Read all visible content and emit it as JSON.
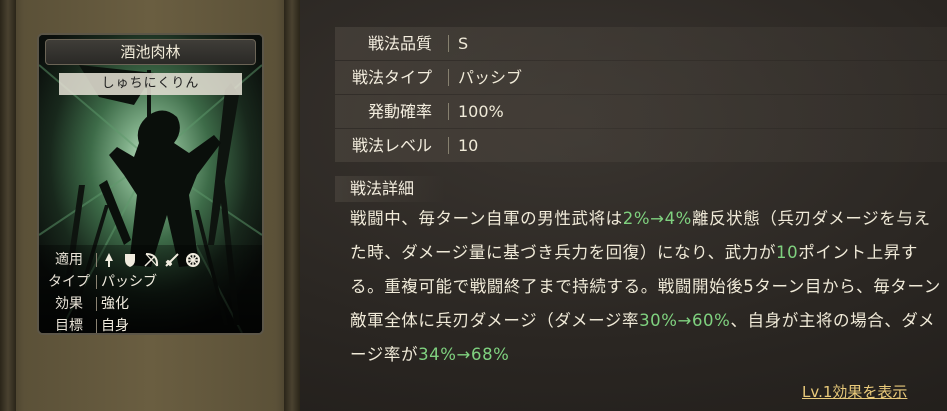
{
  "card": {
    "title": "酒池肉林",
    "reading": "しゅちにくりん",
    "info": [
      {
        "label": "適用",
        "value": ""
      },
      {
        "label": "タイプ",
        "value": "パッシブ"
      },
      {
        "label": "効果",
        "value": "強化"
      },
      {
        "label": "目標",
        "value": "自身"
      }
    ],
    "apply_icons": [
      "spear-icon",
      "shield-icon",
      "bow-icon",
      "sword-icon",
      "siege-icon"
    ]
  },
  "stats": [
    {
      "label": "戦法品質",
      "value": "S"
    },
    {
      "label": "戦法タイプ",
      "value": "パッシブ"
    },
    {
      "label": "発動確率",
      "value": "100%"
    },
    {
      "label": "戦法レベル",
      "value": "10"
    }
  ],
  "detail": {
    "heading": "戦法詳細",
    "parts": [
      {
        "t": "戦闘中、毎ターン自軍の男性武将は"
      },
      {
        "t": "2%→4%",
        "g": true
      },
      {
        "t": "離反状態（兵刃ダメージを与えた時、ダメージ量に基づき兵力を回復）になり、武力が"
      },
      {
        "t": "10",
        "g": true
      },
      {
        "t": "ポイント上昇する。重複可能で戦闘終了まで持続する。戦闘開始後5ターン目から、毎ターン敵軍全体に兵刃ダメージ（ダメージ率"
      },
      {
        "t": "30%→60%",
        "g": true
      },
      {
        "t": "、自身が主将の場合、ダメージ率が"
      },
      {
        "t": "34%→68%",
        "g": true
      }
    ]
  },
  "link": {
    "label": "Lv.1効果を表示"
  },
  "colors": {
    "highlight": "#7fd17f",
    "link": "#e8c97a",
    "accent_green": "#3d6b48"
  }
}
